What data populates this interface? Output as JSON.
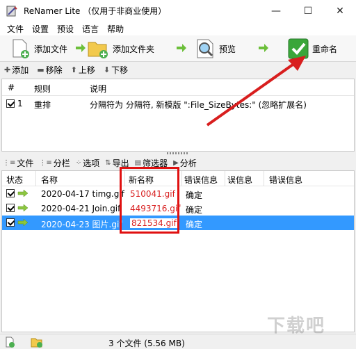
{
  "window": {
    "title": "ReNamer Lite （仅用于非商业使用）",
    "minimize": "—",
    "maximize": "☐",
    "close": "✕"
  },
  "menu": [
    "文件",
    "设置",
    "预设",
    "语言",
    "帮助"
  ],
  "toolbar": {
    "add_files": "添加文件",
    "add_folder": "添加文件夹",
    "preview": "预览",
    "rename": "重命名"
  },
  "rules_toolbar": {
    "add": "添加",
    "remove": "移除",
    "up": "上移",
    "down": "下移"
  },
  "rules": {
    "headers": [
      "#",
      "规则",
      "说明"
    ],
    "rows": [
      {
        "num": "1",
        "rule": "重排",
        "desc": "分隔符为 分隔符, 新模版 \":File_SizeBytes:\" (忽略扩展名)"
      }
    ]
  },
  "files_toolbar": {
    "files": "文件",
    "columns": "分栏",
    "options": "选项",
    "export": "导出",
    "filter": "筛选器",
    "analyze": "分析"
  },
  "files": {
    "headers": [
      "状态",
      "名称",
      "新名称",
      "错误信息",
      "误信息",
      "错误信息"
    ],
    "rows": [
      {
        "name": "2020-04-17 timg.gif",
        "newname": "510041.gif",
        "error": "确定",
        "selected": false
      },
      {
        "name": "2020-04-21 Join.gif",
        "newname": "4493716.gif",
        "error": "确定",
        "selected": false
      },
      {
        "name": "2020-04-23 图片.gif",
        "newname": "821534.gif",
        "error": "确定",
        "selected": true
      }
    ]
  },
  "status": {
    "summary": "3 个文件 (5.56 MB)"
  },
  "colors": {
    "selection": "#3399ff",
    "highlight": "#e01010",
    "newname_text": "#d81e1e",
    "rename_green": "#3aa63a"
  },
  "watermark": "下载吧"
}
